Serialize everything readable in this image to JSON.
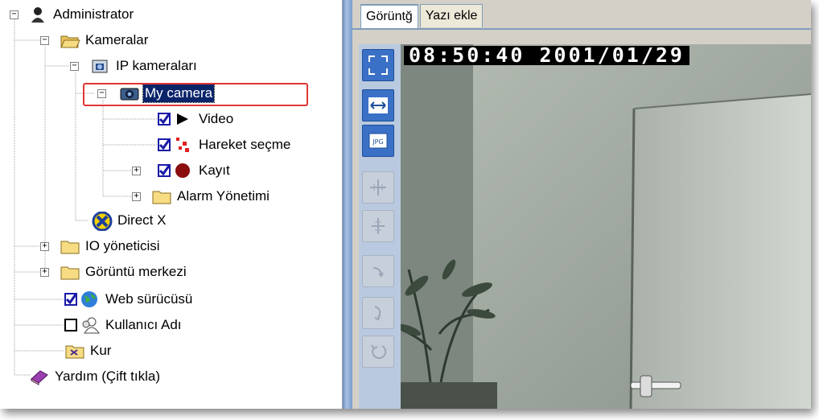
{
  "tree": {
    "root": "Administrator",
    "kameralar": "Kameralar",
    "ip_kameralari": "IP kameraları",
    "my_camera": "My camera",
    "video": "Video",
    "hareket": "Hareket seçme",
    "kayit": "Kayıt",
    "alarm": "Alarm Yönetimi",
    "directx": "Direct X",
    "io": "IO yöneticisi",
    "goruntu_merkezi": "Görüntü merkezi",
    "web": "Web sürücüsü",
    "kullanici": "Kullanıcı Adı",
    "kur": "Kur",
    "yardim": "Yardım (Çift tıkla)"
  },
  "tabs": [
    "Görüntğ",
    "Yazı ekle"
  ],
  "video": {
    "timestamp": "08:50:40 2001/01/29"
  },
  "colors": {
    "selection": "#0a246a",
    "highlight_box": "#e23535",
    "toolbar_on": "#3a70c6"
  }
}
